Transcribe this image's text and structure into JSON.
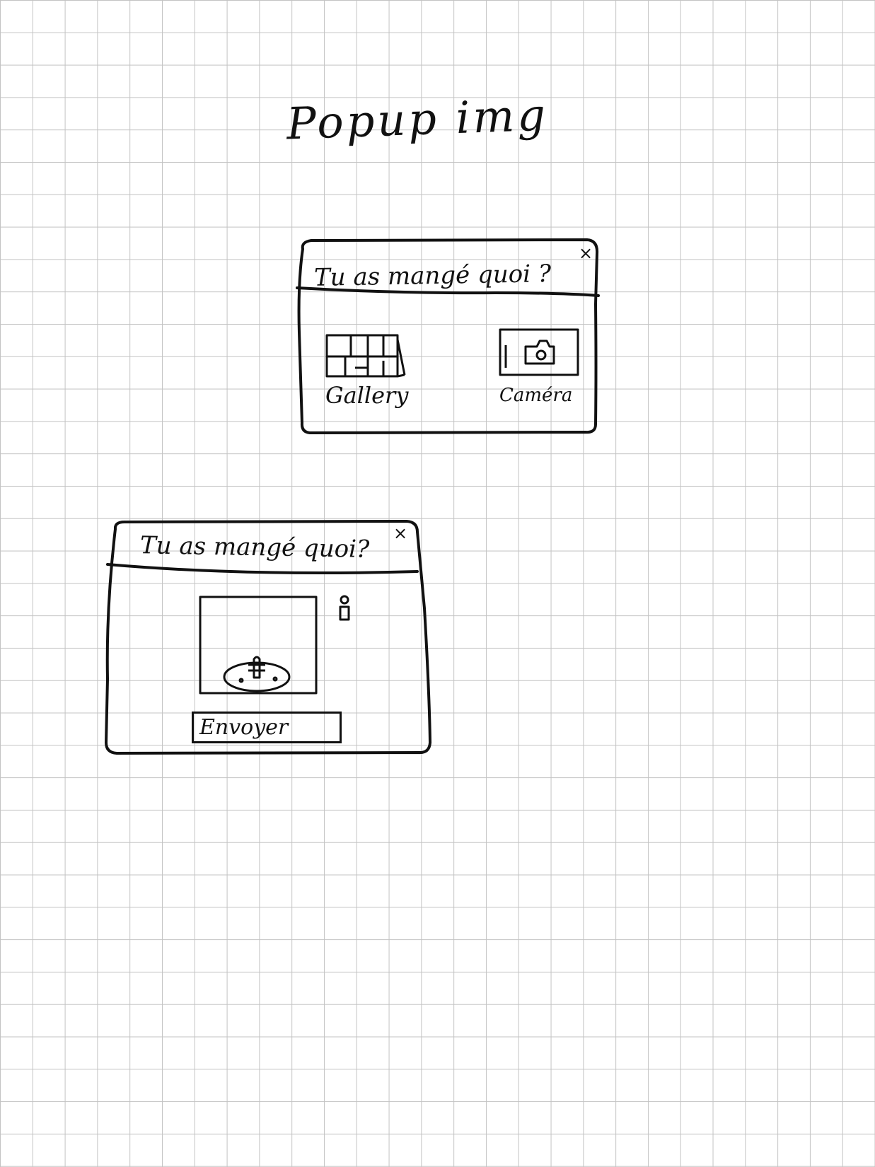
{
  "page": {
    "title": "Popup img"
  },
  "popup_choose": {
    "title": "Tu as mangé quoi ?",
    "close": "×",
    "options": [
      {
        "label": "Gallery",
        "icon": "gallery-icon"
      },
      {
        "label": "Caméra",
        "icon": "camera-icon"
      }
    ]
  },
  "popup_send": {
    "title": "Tu as mangé quoi?",
    "close": "×",
    "preview_icon": "food-plate-icon",
    "info_icon": "info-icon",
    "send_label": "Envoyer"
  },
  "colors": {
    "ink": "#111111",
    "grid": "#c3c3c3",
    "paper": "#ffffff"
  }
}
